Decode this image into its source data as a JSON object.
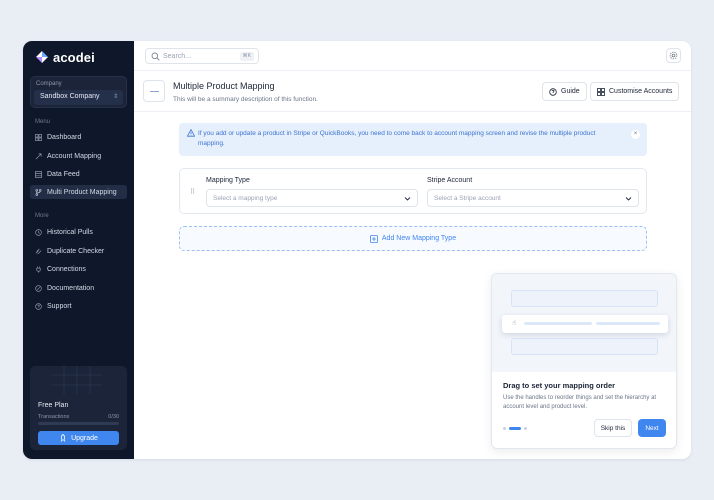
{
  "app": {
    "brand": "acodei"
  },
  "sidebar": {
    "company_label": "Company",
    "company_value": "Sandbox Company",
    "menu_label": "Menu",
    "menu_items": [
      {
        "label": "Dashboard",
        "icon": "grid-icon",
        "active": false
      },
      {
        "label": "Account Mapping",
        "icon": "mapping-icon",
        "active": false
      },
      {
        "label": "Data Feed",
        "icon": "table-icon",
        "active": false
      },
      {
        "label": "Multi Product Mapping",
        "icon": "branch-icon",
        "active": true
      }
    ],
    "more_label": "More",
    "more_items": [
      {
        "label": "Historical Pulls",
        "icon": "history-icon"
      },
      {
        "label": "Duplicate Checker",
        "icon": "duplicate-icon"
      },
      {
        "label": "Connections",
        "icon": "plug-icon"
      },
      {
        "label": "Documentation",
        "icon": "doc-icon"
      },
      {
        "label": "Support",
        "icon": "help-icon"
      }
    ],
    "plan": {
      "title": "Free Plan",
      "transactions_label": "Transactions",
      "transactions_count": "0/30",
      "progress_fraction": 0.0,
      "upgrade_label": "Upgrade"
    }
  },
  "topbar": {
    "search_placeholder": "Search...",
    "search_shortcut": "⌘K"
  },
  "header": {
    "title": "Multiple Product Mapping",
    "subtitle": "This will be a summary description of this function.",
    "guide_label": "Guide",
    "customise_label": "Customise Accounts"
  },
  "alert": {
    "text": "If you add or update a product in Stripe or QuickBooks, you need to come back to account mapping screen and revise the multiple product mapping."
  },
  "mapping": {
    "type_label": "Mapping Type",
    "type_placeholder": "Select a mapping type",
    "stripe_label": "Stripe Account",
    "stripe_placeholder": "Select a Stripe account",
    "add_label": "Add New Mapping Type"
  },
  "onboarding": {
    "title": "Drag to set your mapping order",
    "description": "Use the handles to reorder things and set the hierarchy at account level and product level.",
    "skip_label": "Skip this",
    "next_label": "Next",
    "step_index": 1,
    "step_count": 3
  },
  "colors": {
    "sidebar_bg": "#0f172a",
    "accent": "#3f86ef",
    "alert_bg": "#e6effc",
    "page_bg": "#e9edf4"
  }
}
